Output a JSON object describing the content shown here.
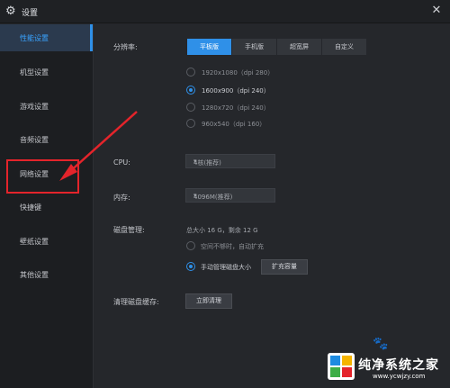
{
  "window": {
    "title": "设置"
  },
  "sidebar": {
    "items": [
      {
        "label": "性能设置",
        "active": true
      },
      {
        "label": "机型设置"
      },
      {
        "label": "游戏设置"
      },
      {
        "label": "音频设置"
      },
      {
        "label": "网络设置"
      },
      {
        "label": "快捷键"
      },
      {
        "label": "壁纸设置"
      },
      {
        "label": "其他设置"
      }
    ]
  },
  "resolution": {
    "label": "分辨率:",
    "tabs": [
      "平板版",
      "手机版",
      "超宽屏",
      "自定义"
    ],
    "options": [
      {
        "label": "1920x1080（dpi 280）",
        "selected": false
      },
      {
        "label": "1600x900（dpi 240）",
        "selected": true
      },
      {
        "label": "1280x720（dpi 240）",
        "selected": false
      },
      {
        "label": "960x540（dpi 160）",
        "selected": false
      }
    ]
  },
  "cpu": {
    "label": "CPU:",
    "value": "4核(推荐)"
  },
  "memory": {
    "label": "内存:",
    "value": "4096M(推荐)"
  },
  "disk": {
    "label": "磁盘管理:",
    "info": "总大小 16 G，剩余 12 G",
    "option_auto": "空间不够时，自动扩充",
    "option_manual": "手动管理磁盘大小",
    "expand_button": "扩充容量"
  },
  "cache": {
    "label": "清理磁盘缓存:",
    "button": "立即清理"
  },
  "watermark": {
    "name": "纯净系统之家",
    "url": "www.ycwjzy.com"
  },
  "colors": {
    "accent": "#2f90e8",
    "annotation": "#e4242b"
  }
}
